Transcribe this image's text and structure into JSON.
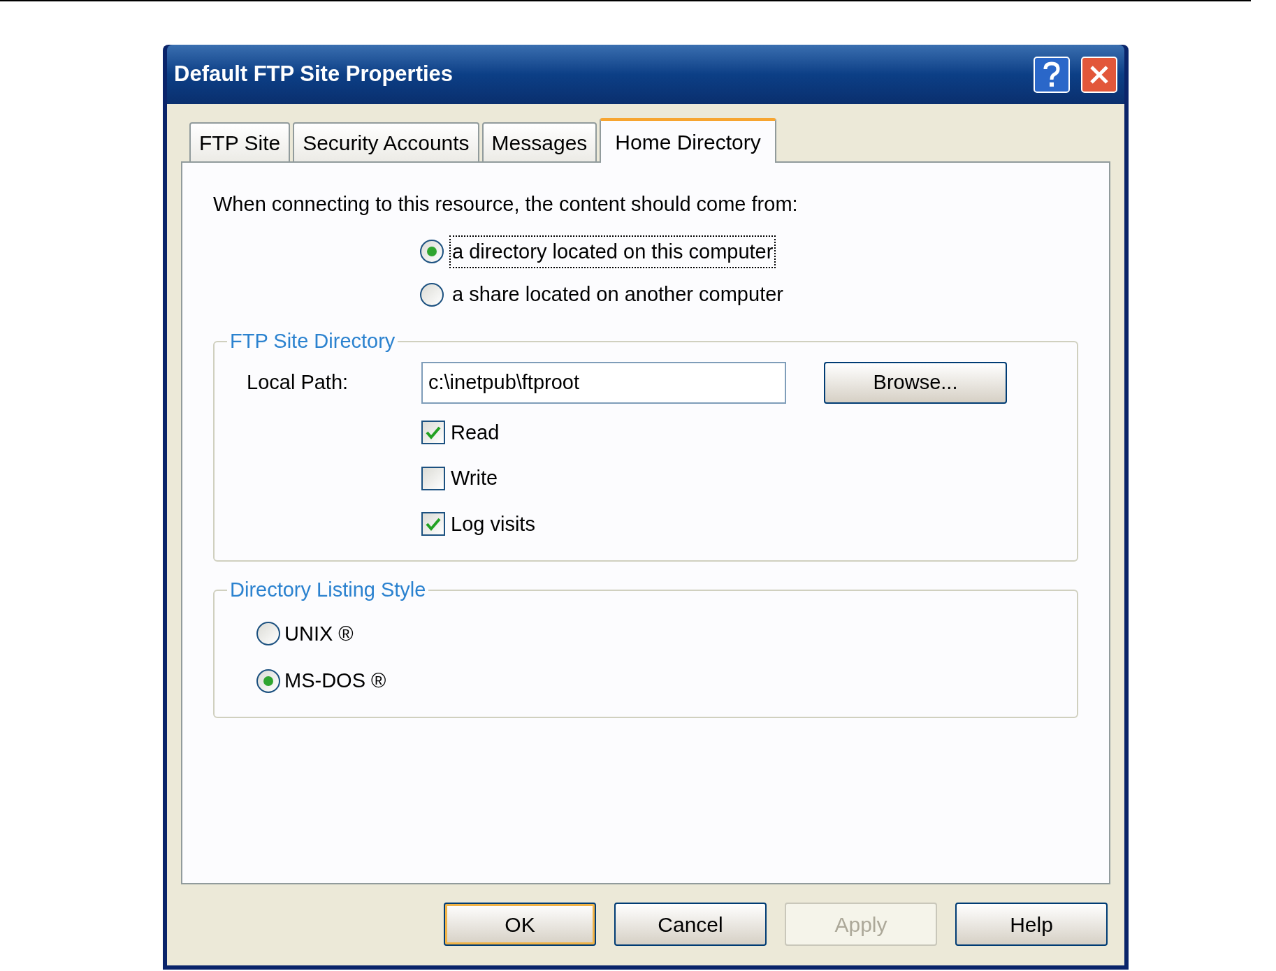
{
  "window": {
    "title": "Default FTP Site Properties"
  },
  "tabs": [
    {
      "label": "FTP Site",
      "selected": false
    },
    {
      "label": "Security Accounts",
      "selected": false
    },
    {
      "label": "Messages",
      "selected": false
    },
    {
      "label": "Home Directory",
      "selected": true
    }
  ],
  "content_source": {
    "prompt": "When connecting to this resource, the content should come from:",
    "options": [
      {
        "label": "a directory located on this computer",
        "selected": true,
        "focused": true
      },
      {
        "label": "a share located on another computer",
        "selected": false,
        "focused": false
      }
    ]
  },
  "ftp_site_directory": {
    "title": "FTP Site Directory",
    "local_path": {
      "label": "Local Path:",
      "value": "c:\\inetpub\\ftproot"
    },
    "browse_button": "Browse...",
    "permissions": [
      {
        "label": "Read",
        "checked": true
      },
      {
        "label": "Write",
        "checked": false
      },
      {
        "label": "Log visits",
        "checked": true
      }
    ]
  },
  "directory_listing_style": {
    "title": "Directory Listing Style",
    "options": [
      {
        "label": "UNIX ®",
        "selected": false
      },
      {
        "label": "MS-DOS ®",
        "selected": true
      }
    ]
  },
  "buttons": [
    {
      "label": "OK",
      "default": true,
      "disabled": false
    },
    {
      "label": "Cancel",
      "default": false,
      "disabled": false
    },
    {
      "label": "Apply",
      "default": false,
      "disabled": true
    },
    {
      "label": "Help",
      "default": false,
      "disabled": false
    }
  ]
}
